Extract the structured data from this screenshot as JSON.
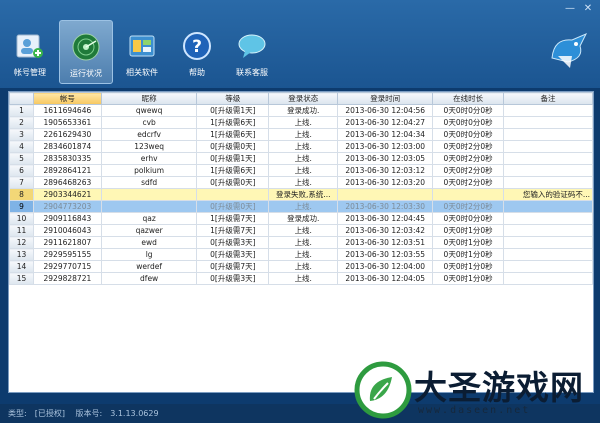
{
  "toolbar": {
    "items": [
      {
        "label": "帐号管理",
        "icon": "account-icon",
        "active": false
      },
      {
        "label": "运行状况",
        "icon": "radar-icon",
        "active": true
      },
      {
        "label": "相关软件",
        "icon": "software-icon",
        "active": false
      },
      {
        "label": "帮助",
        "icon": "help-icon",
        "active": false
      },
      {
        "label": "联系客服",
        "icon": "chat-bubble-icon",
        "active": false
      }
    ]
  },
  "window_controls": {
    "minimize": "—",
    "close": "✕"
  },
  "table": {
    "columns": [
      "",
      "帐号",
      "昵称",
      "等级",
      "登录状态",
      "登录时间",
      "在线时长",
      "备注"
    ],
    "rows": [
      {
        "n": "1",
        "account": "1611694646",
        "nick": "qwewq",
        "level": "0[升级需1天]",
        "status": "登录成功.",
        "time": "2013-06-30 12:04:56",
        "duration": "0天0时0分0秒",
        "note": ""
      },
      {
        "n": "2",
        "account": "1905653361",
        "nick": "cvb",
        "level": "1[升级需6天]",
        "status": "上线.",
        "time": "2013-06-30 12:04:27",
        "duration": "0天0时0分0秒",
        "note": ""
      },
      {
        "n": "3",
        "account": "2261629430",
        "nick": "edcrfv",
        "level": "1[升级需6天]",
        "status": "上线.",
        "time": "2013-06-30 12:04:34",
        "duration": "0天0时0分0秒",
        "note": ""
      },
      {
        "n": "4",
        "account": "2834601874",
        "nick": "123weq",
        "level": "0[升级需0天]",
        "status": "上线.",
        "time": "2013-06-30 12:03:00",
        "duration": "0天0时2分0秒",
        "note": ""
      },
      {
        "n": "5",
        "account": "2835830335",
        "nick": "erhv",
        "level": "0[升级需1天]",
        "status": "上线.",
        "time": "2013-06-30 12:03:05",
        "duration": "0天0时2分0秒",
        "note": ""
      },
      {
        "n": "6",
        "account": "2892864121",
        "nick": "polkium",
        "level": "1[升级需6天]",
        "status": "上线.",
        "time": "2013-06-30 12:03:12",
        "duration": "0天0时2分0秒",
        "note": ""
      },
      {
        "n": "7",
        "account": "2896468263",
        "nick": "sdfd",
        "level": "0[升级需0天]",
        "status": "上线.",
        "time": "2013-06-30 12:03:20",
        "duration": "0天0时2分0秒",
        "note": ""
      },
      {
        "n": "8",
        "account": "2903344621",
        "nick": "",
        "level": "",
        "status": "登录失败,系统...",
        "time": "",
        "duration": "",
        "note": "您输入的验证码不..."
      },
      {
        "n": "9",
        "account": "2904773203",
        "nick": "",
        "level": "0[升级需0天]",
        "status": "上线.",
        "time": "2013-06-30 12:03:30",
        "duration": "0天0时2分0秒",
        "note": ""
      },
      {
        "n": "10",
        "account": "2909116843",
        "nick": "qaz",
        "level": "1[升级需7天]",
        "status": "登录成功.",
        "time": "2013-06-30 12:04:45",
        "duration": "0天0时0分0秒",
        "note": ""
      },
      {
        "n": "11",
        "account": "2910046043",
        "nick": "qazwer",
        "level": "1[升级需7天]",
        "status": "上线.",
        "time": "2013-06-30 12:03:42",
        "duration": "0天0时1分0秒",
        "note": ""
      },
      {
        "n": "12",
        "account": "2911621807",
        "nick": "ewd",
        "level": "0[升级需3天]",
        "status": "上线.",
        "time": "2013-06-30 12:03:51",
        "duration": "0天0时1分0秒",
        "note": ""
      },
      {
        "n": "13",
        "account": "2929595155",
        "nick": "lg",
        "level": "0[升级需3天]",
        "status": "上线.",
        "time": "2013-06-30 12:03:55",
        "duration": "0天0时1分0秒",
        "note": ""
      },
      {
        "n": "14",
        "account": "2929770715",
        "nick": "werdef",
        "level": "0[升级需7天]",
        "status": "上线.",
        "time": "2013-06-30 12:04:00",
        "duration": "0天0时1分0秒",
        "note": ""
      },
      {
        "n": "15",
        "account": "2929828721",
        "nick": "dfew",
        "level": "0[升级需3天]",
        "status": "上线.",
        "time": "2013-06-30 12:04:05",
        "duration": "0天0时1分0秒",
        "note": ""
      }
    ]
  },
  "status_bar": {
    "type_label": "类型:",
    "type_value": "[已授权]",
    "version_label": "版本号:",
    "version_value": "3.1.13.0629"
  },
  "watermark": {
    "title": "大圣游戏网",
    "url": "www.daseen.net"
  },
  "colors": {
    "highlight_row": "#fff7b5",
    "selected_row": "#9ec8f0",
    "header_selected": "#f6c760"
  }
}
